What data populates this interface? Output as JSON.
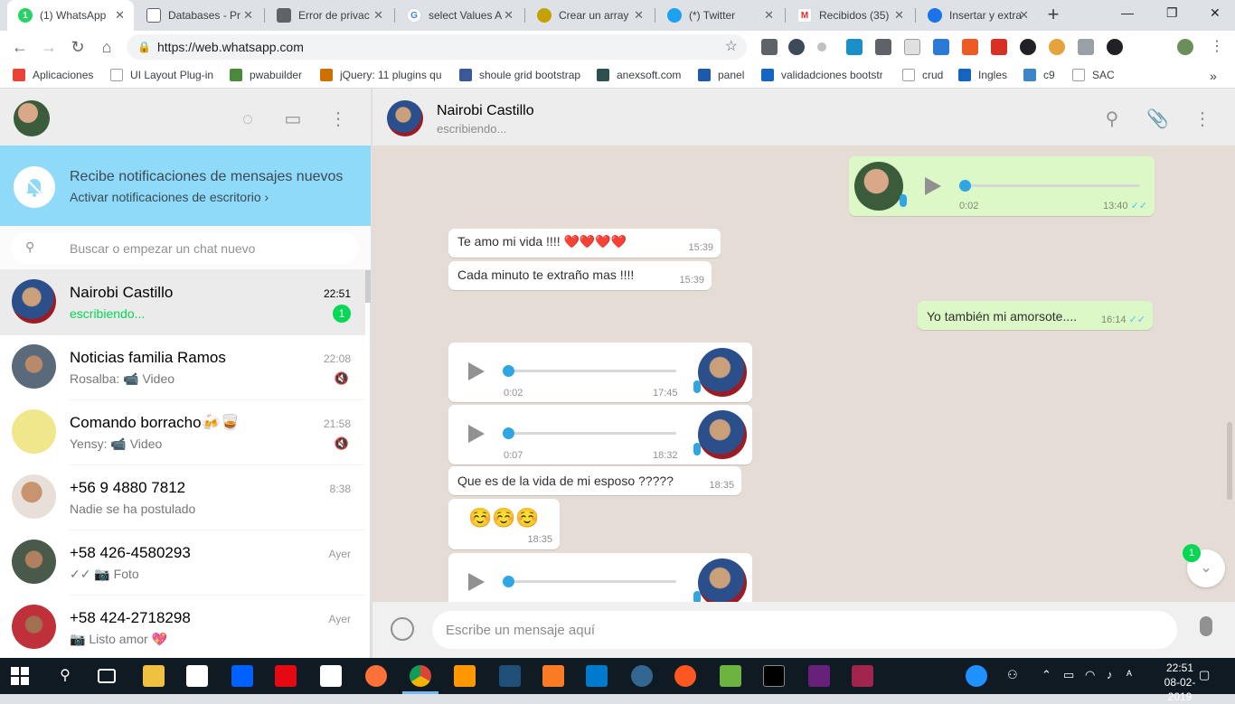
{
  "browser": {
    "tabs": [
      {
        "title": "(1) WhatsApp",
        "color": "#25d366",
        "glyph": "1"
      },
      {
        "title": "Databases - Pr",
        "color": "#5f6368",
        "glyph": ""
      },
      {
        "title": "Error de privac",
        "color": "#5f6368",
        "glyph": ""
      },
      {
        "title": "select Values A",
        "color": "#4285f4",
        "glyph": "G"
      },
      {
        "title": "Crear un array",
        "color": "#c4a000",
        "glyph": ""
      },
      {
        "title": "(*) Twitter",
        "color": "#1da1f2",
        "glyph": ""
      },
      {
        "title": "Recibidos (35)",
        "color": "#d93025",
        "glyph": "M"
      },
      {
        "title": "Insertar y extra",
        "color": "#1a73e8",
        "glyph": ""
      }
    ],
    "url": "https://web.whatsapp.com",
    "bookmarks": [
      {
        "label": "Aplicaciones",
        "color": "#ea4335"
      },
      {
        "label": "UI Layout Plug-in",
        "color": "#9aa0a6"
      },
      {
        "label": "pwabuilder",
        "color": "#4a8a3a"
      },
      {
        "label": "jQuery: 11 plugins qu",
        "color": "#cc7000"
      },
      {
        "label": "shoule grid bootstrap",
        "color": "#3b5998"
      },
      {
        "label": "anexsoft.com",
        "color": "#2f4f4f"
      },
      {
        "label": "panel",
        "color": "#1e5aa8"
      },
      {
        "label": "validadciones bootstr",
        "color": "#1565c0"
      },
      {
        "label": "crud",
        "color": "#9aa0a6"
      },
      {
        "label": "Ingles",
        "color": "#1565c0"
      },
      {
        "label": "c9",
        "color": "#3d85c6"
      },
      {
        "label": "SAC",
        "color": "#9aa0a6"
      }
    ]
  },
  "notification": {
    "title": "Recibe notificaciones de mensajes nuevos",
    "subtitle": "Activar notificaciones de escritorio ›"
  },
  "search": {
    "placeholder": "Buscar o empezar un chat nuevo"
  },
  "chats": [
    {
      "name": "Nairobi Castillo",
      "time": "22:51",
      "preview": "escribiendo...",
      "badge": "1"
    },
    {
      "name": "Noticias familia Ramos",
      "time": "22:08",
      "preview": "Rosalba: 📹 Video"
    },
    {
      "name": "Comando borracho🍻🥃",
      "time": "21:58",
      "preview": "Yensy: 📹 Video"
    },
    {
      "name": "+56 9 4880 7812",
      "time": "8:38",
      "preview": "Nadie se ha postulado"
    },
    {
      "name": "+58 426-4580293",
      "time": "Ayer",
      "preview": "✓✓ 📷 Foto"
    },
    {
      "name": "+58 424-2718298",
      "time": "Ayer",
      "preview": "📷 Listo amor 💖"
    }
  ],
  "conversation": {
    "contact_name": "Nairobi Castillo",
    "status": "escribiendo...",
    "messages": [
      {
        "kind": "audio",
        "dir": "out",
        "duration": "0:02",
        "time": "13:40"
      },
      {
        "kind": "text",
        "dir": "in",
        "text": "Te amo mi vida !!!! ❤️❤️❤️❤️",
        "time": "15:39"
      },
      {
        "kind": "text",
        "dir": "in",
        "text": "Cada minuto te extraño mas !!!!",
        "time": "15:39"
      },
      {
        "kind": "text",
        "dir": "out",
        "text": "Yo también mi amorsote....",
        "time": "16:14"
      },
      {
        "kind": "audio",
        "dir": "in",
        "duration": "0:02",
        "time": "17:45"
      },
      {
        "kind": "audio",
        "dir": "in",
        "duration": "0:07",
        "time": "18:32"
      },
      {
        "kind": "text",
        "dir": "in",
        "text": "Que es de la vida de mi esposo ?????",
        "time": "18:35"
      },
      {
        "kind": "text",
        "dir": "in",
        "text": "☺️☺️☺️",
        "time": "18:35"
      },
      {
        "kind": "audio",
        "dir": "in",
        "duration": "",
        "time": ""
      }
    ],
    "unread_badge": "1",
    "input_placeholder": "Escribe un mensaje aquí"
  },
  "taskbar": {
    "time": "22:51",
    "date": "08-02-2019"
  },
  "colors": {
    "accent": "#06d755",
    "notif_bg": "#8fd9f9",
    "outgoing": "#dcf8c6",
    "chat_bg": "#e5ddd5"
  }
}
